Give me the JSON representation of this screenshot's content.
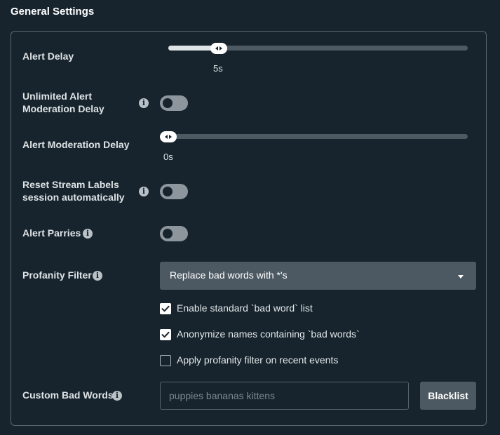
{
  "section": {
    "title": "General Settings"
  },
  "alert_delay": {
    "label": "Alert Delay",
    "value_text": "5s",
    "value_fraction": 0.17
  },
  "unlimited_moderation": {
    "label_line1": "Unlimited Alert",
    "label_line2": "Moderation Delay",
    "enabled": false
  },
  "moderation_delay": {
    "label": "Alert Moderation Delay",
    "value_text": "0s",
    "value_fraction": 0
  },
  "reset_labels": {
    "label_line1": "Reset Stream Labels",
    "label_line2": "session automatically",
    "enabled": false
  },
  "alert_parries": {
    "label": "Alert Parries",
    "enabled": false
  },
  "profanity": {
    "label": "Profanity Filter",
    "selected": "Replace bad words with *'s",
    "checkboxes": [
      {
        "label": "Enable standard `bad word` list",
        "checked": true
      },
      {
        "label": "Anonymize names containing `bad words`",
        "checked": true
      },
      {
        "label": "Apply profanity filter on recent events",
        "checked": false
      }
    ]
  },
  "custom_bad_words": {
    "label": "Custom Bad Words",
    "placeholder": "puppies bananas kittens",
    "value": "",
    "button_label": "Blacklist"
  },
  "icons": {
    "info": "info-icon",
    "caret": "caret-down-icon",
    "check": "checkmark-icon"
  },
  "colors": {
    "background": "#17242d",
    "panel_border": "#5b6770",
    "control": "#4d5962",
    "toggle_off": "#8d969c"
  }
}
